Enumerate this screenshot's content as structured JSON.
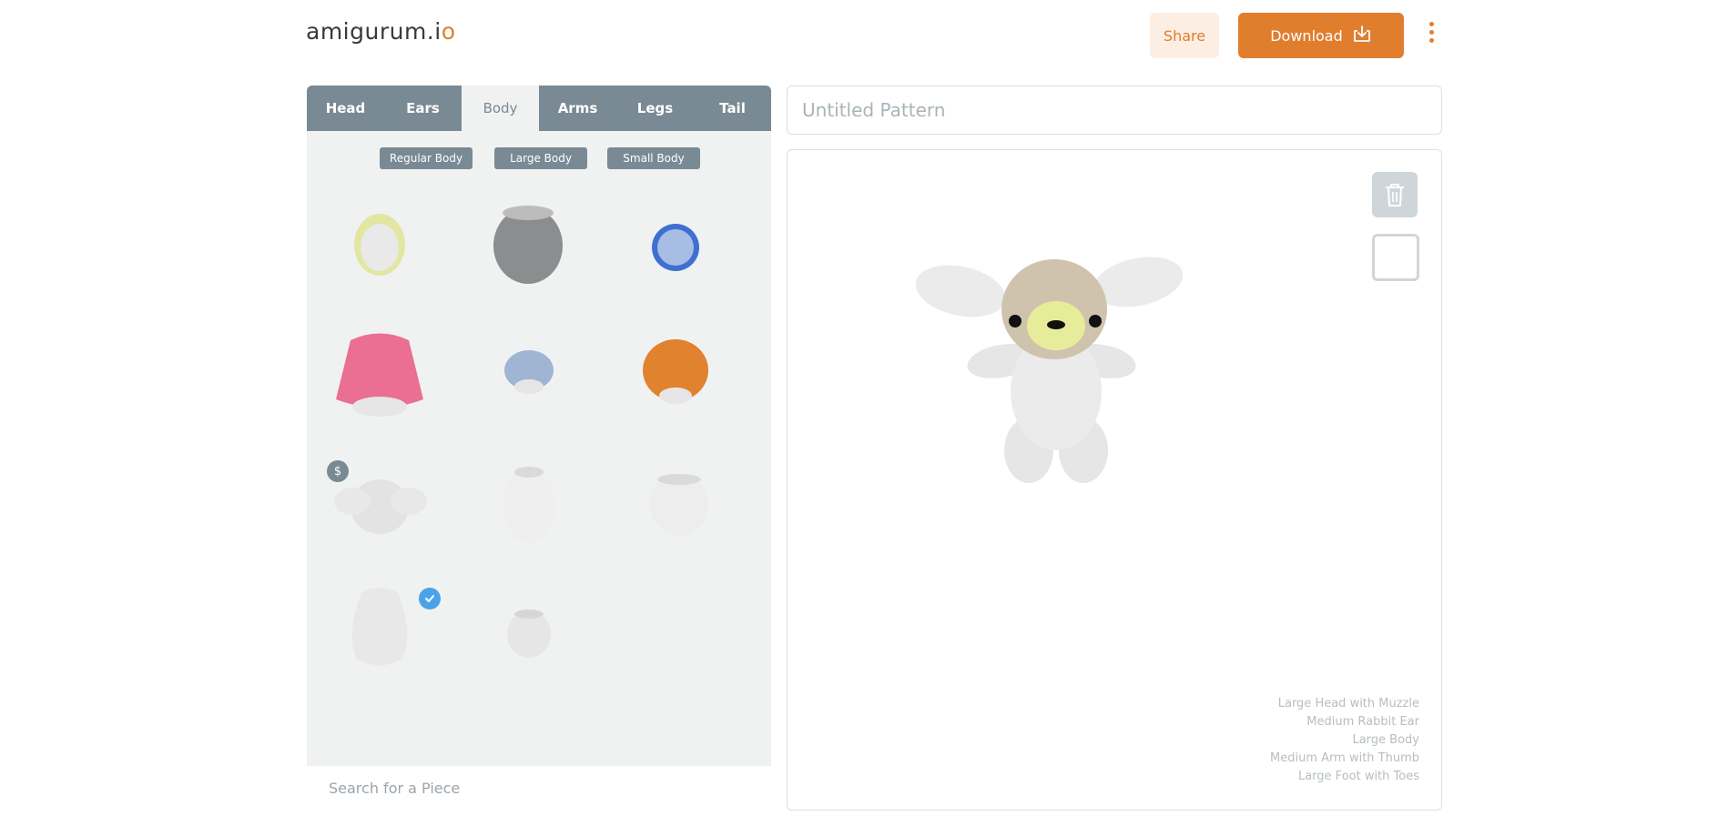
{
  "app": {
    "logo_main": "amigurum.i",
    "logo_accent": "o"
  },
  "header": {
    "share_label": "Share",
    "download_label": "Download",
    "download_icon": "download-icon",
    "more_icon": "more-vertical-icon"
  },
  "tabs": [
    {
      "label": "Head"
    },
    {
      "label": "Ears"
    },
    {
      "label": "Body",
      "active": true
    },
    {
      "label": "Arms"
    },
    {
      "label": "Legs"
    },
    {
      "label": "Tail"
    }
  ],
  "filters": [
    {
      "label": "Regular Body"
    },
    {
      "label": "Large Body"
    },
    {
      "label": "Small Body"
    }
  ],
  "pieces": [
    {
      "name": "body-yellow-rim",
      "color": "#e3e6a0"
    },
    {
      "name": "body-grey",
      "color": "#8b8d8e"
    },
    {
      "name": "body-blue-rim",
      "color": "#3f6fd0"
    },
    {
      "name": "body-pink-cone",
      "color": "#ea6f93"
    },
    {
      "name": "body-small-blue",
      "color": "#9fb5d3"
    },
    {
      "name": "body-orange",
      "color": "#e0822e"
    },
    {
      "name": "body-with-arms",
      "color": "#e6e6e6",
      "premium": true,
      "premium_icon": "dollar-icon"
    },
    {
      "name": "body-tall-white",
      "color": "#efefef"
    },
    {
      "name": "body-wide-white",
      "color": "#ededed"
    },
    {
      "name": "body-large",
      "color": "#e8e8e8",
      "selected": true,
      "selected_icon": "check-circle-icon"
    },
    {
      "name": "body-small-white",
      "color": "#e6e6e6"
    }
  ],
  "search": {
    "placeholder": "Search for a Piece"
  },
  "pattern": {
    "title_placeholder": "Untitled Pattern"
  },
  "viewer": {
    "trash_icon": "trash-icon",
    "view_toggle_icon": "square-icon",
    "colors": {
      "head": "#cfc3ad",
      "muzzle": "#e7ec9a",
      "body": "#ebebeb",
      "eyes": "#111111"
    },
    "pieces_used": [
      "Large Head with Muzzle",
      "Medium Rabbit Ear",
      "Large Body",
      "Medium Arm with Thumb",
      "Large Foot with Toes"
    ]
  },
  "colors": {
    "accent": "#e07e2e",
    "accent_light": "#fdeee3",
    "tab_bar": "#7a8a94",
    "panel_bg": "#f0f2f2",
    "selected_badge": "#4aa3e8"
  }
}
